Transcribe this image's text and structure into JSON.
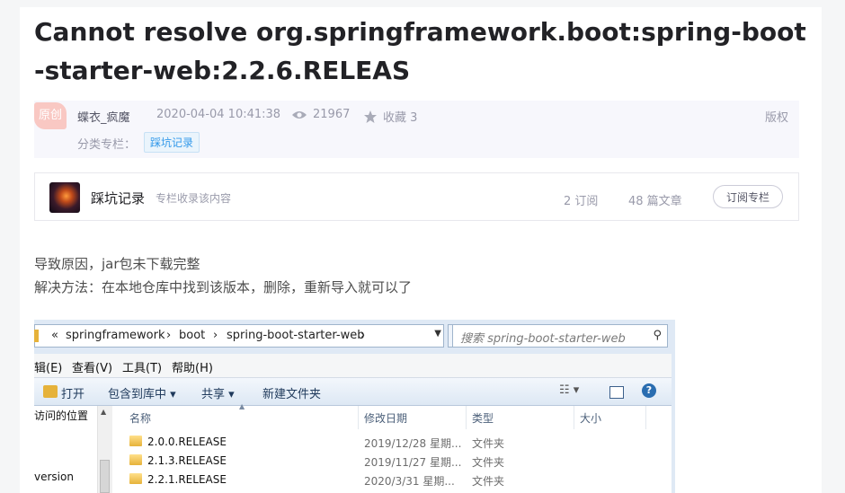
{
  "article": {
    "title": "Cannot resolve org.springframework.boot:spring-boot-starter-web:2.2.6.RELEAS",
    "original_badge": "原创",
    "author": "蝶衣_疯魔",
    "datetime": "2020-04-04 10:41:38",
    "views": "21967",
    "favorites_label": "收藏 3",
    "copyright_label": "版权",
    "category_label": "分类专栏：",
    "category_tag": "踩坑记录"
  },
  "column": {
    "name": "踩坑记录",
    "desc": "专栏收录该内容",
    "subscribers": "2 订阅",
    "articles": "48 篇文章",
    "subscribe_button": "订阅专栏"
  },
  "body": {
    "line1": "导致原因，jar包未下载完整",
    "line2": "解决方法：在本地仓库中找到该版本，删除，重新导入就可以了"
  },
  "explorer": {
    "address": {
      "arrow": "«",
      "seg1": "springframework",
      "seg2": "boot",
      "seg3": "spring-boot-starter-web"
    },
    "search_placeholder": "搜索 spring-boot-starter-web",
    "menu": [
      "编辑(E)",
      "查看(V)",
      "工具(T)",
      "帮助(H)"
    ],
    "menu_cut_first": "辑(E)",
    "toolbar": {
      "open": "打开",
      "include": "包含到库中 ▾",
      "share": "共享 ▾",
      "new_folder": "新建文件夹"
    },
    "left_items": [
      "访问的位置",
      "version"
    ],
    "columns": {
      "name": "名称",
      "modified": "修改日期",
      "type": "类型",
      "size": "大小"
    },
    "rows": [
      {
        "name": "2.0.0.RELEASE",
        "date": "2019/12/28 星期...",
        "type": "文件夹"
      },
      {
        "name": "2.1.3.RELEASE",
        "date": "2019/11/27 星期...",
        "type": "文件夹"
      },
      {
        "name": "2.2.1.RELEASE",
        "date": "2020/3/31 星期...",
        "type": "文件夹"
      }
    ]
  }
}
